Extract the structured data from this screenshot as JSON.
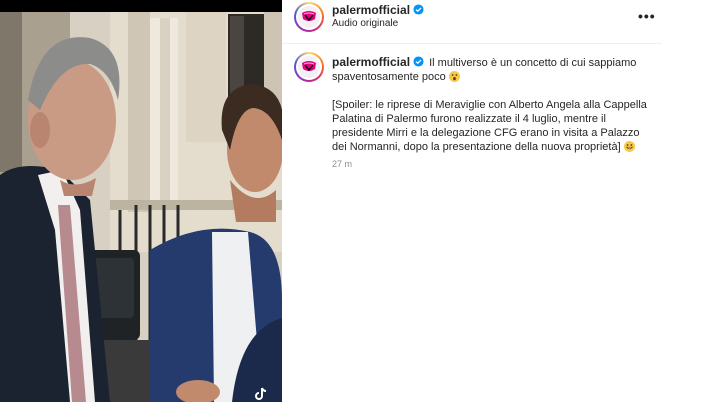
{
  "post": {
    "author": {
      "username": "palermofficial",
      "verified": true,
      "avatar_label": "PALERMO F.C."
    },
    "audio_label": "Audio originale",
    "more_options_label": "•••",
    "caption": {
      "line1": "Il multiverso è un concetto di cui sappiamo spaventosamente poco",
      "emoji1": "astonished-face-emoji",
      "spoiler": "[Spoiler: le riprese di Meraviglie con Alberto Angela alla Cappella Palatina di Palermo furono realizzate il 4 luglio, mentre il presidente Mirri e la delegazione CFG erano in visita a Palazzo dei Normanni, dopo la presentazione della nuova proprietà]",
      "emoji2": "grinning-face-emoji"
    },
    "timestamp": "27 m"
  },
  "colors": {
    "verified": "#0095f6",
    "brand_pink": "#e6007e",
    "text": "#262626",
    "muted": "#8e8e8e"
  },
  "media": {
    "watermark": "tiktok-logo"
  }
}
